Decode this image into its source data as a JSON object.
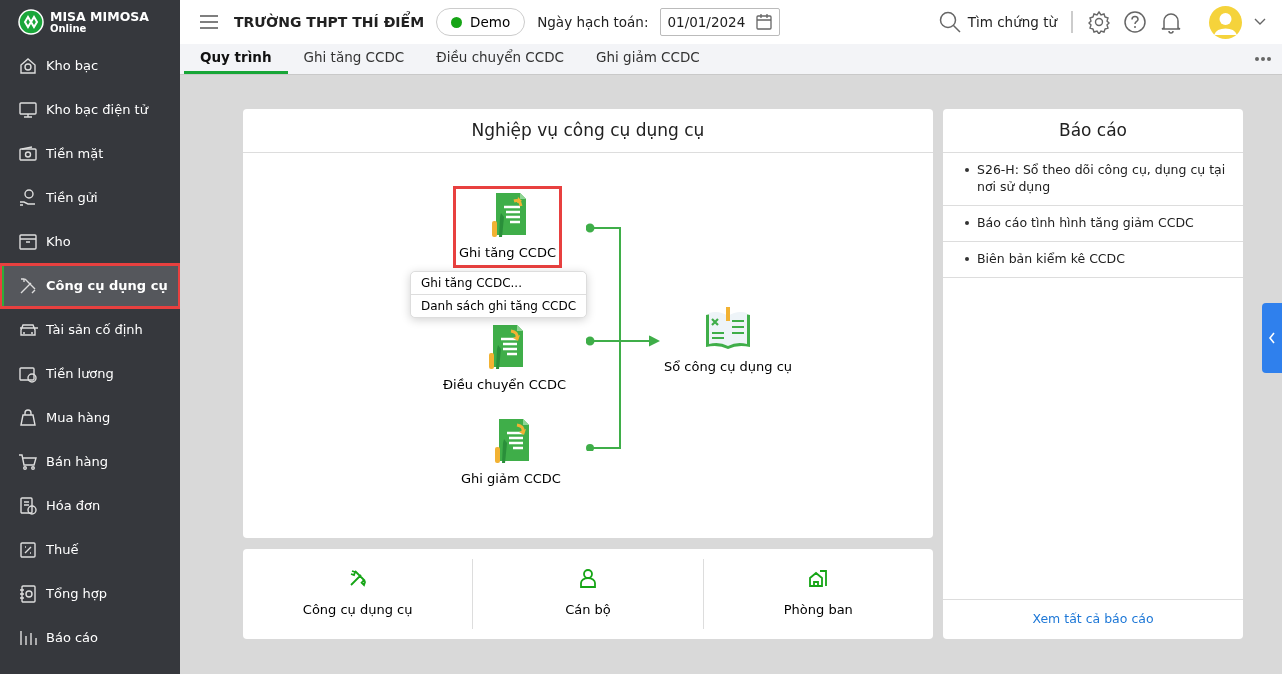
{
  "brand": {
    "name": "MISA MIMOSA",
    "sub": "Online"
  },
  "sidebar": {
    "items": [
      {
        "label": "Kho bạc",
        "selected": false,
        "highlighted": false
      },
      {
        "label": "Kho bạc điện tử",
        "selected": false,
        "highlighted": false
      },
      {
        "label": "Tiền mặt",
        "selected": false,
        "highlighted": false
      },
      {
        "label": "Tiền gửi",
        "selected": false,
        "highlighted": false
      },
      {
        "label": "Kho",
        "selected": false,
        "highlighted": false
      },
      {
        "label": "Công cụ dụng cụ",
        "selected": true,
        "highlighted": true
      },
      {
        "label": "Tài sản cố định",
        "selected": false,
        "highlighted": false
      },
      {
        "label": "Tiền lương",
        "selected": false,
        "highlighted": false
      },
      {
        "label": "Mua hàng",
        "selected": false,
        "highlighted": false
      },
      {
        "label": "Bán hàng",
        "selected": false,
        "highlighted": false
      },
      {
        "label": "Hóa đơn",
        "selected": false,
        "highlighted": false
      },
      {
        "label": "Thuế",
        "selected": false,
        "highlighted": false
      },
      {
        "label": "Tổng hợp",
        "selected": false,
        "highlighted": false
      },
      {
        "label": "Báo cáo",
        "selected": false,
        "highlighted": false
      }
    ]
  },
  "header": {
    "title": "TRƯỜNG THPT THÍ ĐIỂM",
    "mode": "Demo",
    "date_label": "Ngày hạch toán:",
    "date": "01/01/2024",
    "search": "Tìm chứng từ"
  },
  "tabs": [
    {
      "label": "Quy trình",
      "selected": true
    },
    {
      "label": "Ghi tăng CCDC",
      "selected": false
    },
    {
      "label": "Điều chuyển CCDC",
      "selected": false
    },
    {
      "label": "Ghi giảm CCDC",
      "selected": false
    }
  ],
  "process": {
    "title": "Nghiệp vụ công cụ dụng cụ",
    "nodes": [
      {
        "label": "Ghi tăng CCDC",
        "kind": "up",
        "highlighted": true
      },
      {
        "label": "Điều chuyển CCDC",
        "kind": "move",
        "highlighted": false
      },
      {
        "label": "Ghi giảm CCDC",
        "kind": "down",
        "highlighted": false
      },
      {
        "label": "Sổ công cụ dụng cụ",
        "kind": "book",
        "highlighted": false
      }
    ],
    "menu": [
      "Ghi tăng CCDC...",
      "Danh sách ghi tăng CCDC"
    ]
  },
  "shortcuts": [
    {
      "label": "Công cụ dụng cụ",
      "kind": "tools"
    },
    {
      "label": "Cán bộ",
      "kind": "person"
    },
    {
      "label": "Phòng ban",
      "kind": "building"
    }
  ],
  "reports": {
    "title": "Báo cáo",
    "items": [
      "S26-H: Sổ theo dõi công cụ, dụng cụ tại nơi sử dụng",
      "Báo cáo tình hình tăng giảm CCDC",
      "Biên bản kiểm kê CCDC"
    ],
    "link": "Xem tất cả báo cáo"
  }
}
